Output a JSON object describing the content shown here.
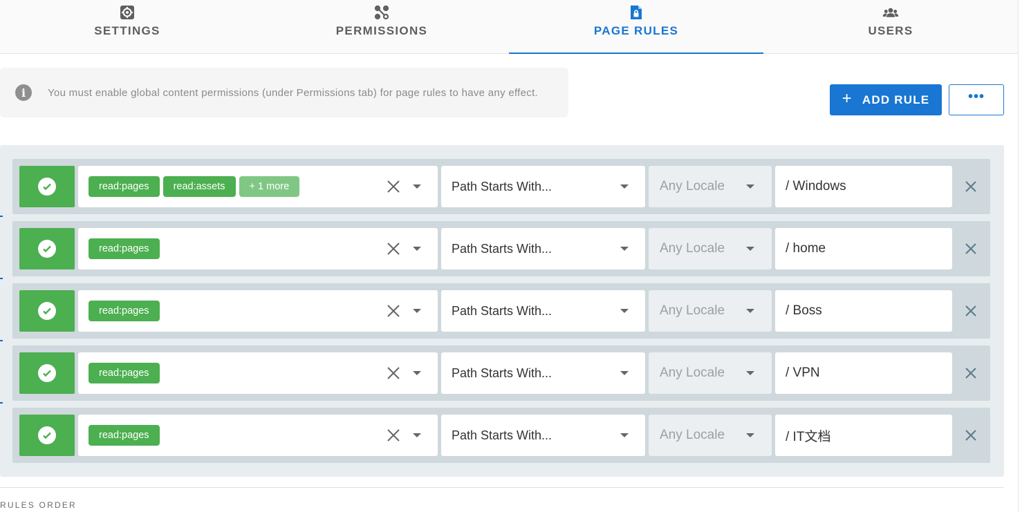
{
  "tabs": [
    {
      "label": "SETTINGS",
      "icon": "gear-icon",
      "active": false
    },
    {
      "label": "PERMISSIONS",
      "icon": "share-nodes-icon",
      "active": false
    },
    {
      "label": "PAGE RULES",
      "icon": "file-lock-icon",
      "active": true
    },
    {
      "label": "USERS",
      "icon": "users-icon",
      "active": false
    }
  ],
  "alert": {
    "icon": "info-icon",
    "text": "You must enable global content permissions (under Permissions tab) for page rules to have any effect."
  },
  "actions": {
    "add_rule_label": "ADD RULE",
    "more_label": "•••"
  },
  "rules": [
    {
      "permissions": [
        "read:pages",
        "read:assets"
      ],
      "more": "+ 1 more",
      "match": "Path Starts With...",
      "locale": "Any Locale",
      "path": "/ Windows"
    },
    {
      "permissions": [
        "read:pages"
      ],
      "more": "",
      "match": "Path Starts With...",
      "locale": "Any Locale",
      "path": "/ home"
    },
    {
      "permissions": [
        "read:pages"
      ],
      "more": "",
      "match": "Path Starts With...",
      "locale": "Any Locale",
      "path": "/ Boss"
    },
    {
      "permissions": [
        "read:pages"
      ],
      "more": "",
      "match": "Path Starts With...",
      "locale": "Any Locale",
      "path": "/ VPN"
    },
    {
      "permissions": [
        "read:pages"
      ],
      "more": "",
      "match": "Path Starts With...",
      "locale": "Any Locale",
      "path": "/ IT文档"
    }
  ],
  "footer": {
    "rules_order_label": "RULES ORDER"
  },
  "colors": {
    "primary": "#1976d2",
    "allow": "#4caf50",
    "chip_more": "#81c784",
    "rule_row": "#cfd8dc"
  }
}
